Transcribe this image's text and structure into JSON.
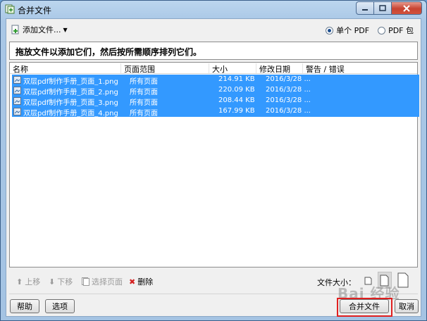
{
  "window": {
    "title": "合并文件"
  },
  "toolbar": {
    "add_files_label": "添加文件...",
    "radio_single": "单个 PDF",
    "radio_package": "PDF 包"
  },
  "instruction": "拖放文件以添加它们，然后按所需顺序排列它们。",
  "list": {
    "columns": [
      "名称",
      "页面范围",
      "大小",
      "修改日期",
      "警告 / 错误"
    ],
    "rows": [
      {
        "name": "双层pdf制作手册_页面_1.png",
        "range": "所有页面",
        "size": "214.91 KB",
        "date": "2016/3/28 ..."
      },
      {
        "name": "双层pdf制作手册_页面_2.png",
        "range": "所有页面",
        "size": "220.09 KB",
        "date": "2016/3/28 ..."
      },
      {
        "name": "双层pdf制作手册_页面_3.png",
        "range": "所有页面",
        "size": "208.44 KB",
        "date": "2016/3/28 ..."
      },
      {
        "name": "双层pdf制作手册_页面_4.png",
        "range": "所有页面",
        "size": "167.99 KB",
        "date": "2016/3/28 ..."
      }
    ]
  },
  "bottombar": {
    "move_up": "上移",
    "move_down": "下移",
    "select_pages": "选择页面",
    "delete": "删除",
    "file_size_label": "文件大小："
  },
  "footer": {
    "help": "帮助",
    "options": "选项",
    "merge": "合并文件",
    "cancel": "取消"
  },
  "watermark": "Bai 经验",
  "colors": {
    "selection": "#3399ff",
    "highlight_box": "#e02020"
  }
}
